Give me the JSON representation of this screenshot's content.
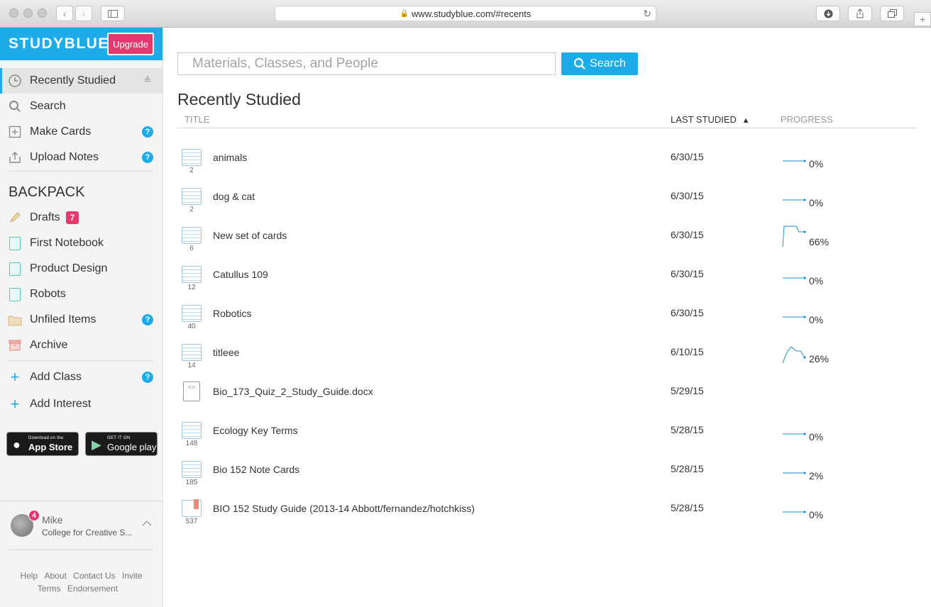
{
  "browser": {
    "url": "www.studyblue.com/#recents"
  },
  "sidebar": {
    "logo": "STUDYBLUE",
    "upgrade_label": "Upgrade",
    "nav": [
      {
        "label": "Recently Studied",
        "icon": "clock-icon",
        "active": true
      },
      {
        "label": "Search",
        "icon": "search-icon"
      },
      {
        "label": "Make Cards",
        "icon": "plus-square-icon",
        "help": "?"
      },
      {
        "label": "Upload Notes",
        "icon": "upload-icon",
        "help": "?"
      }
    ],
    "backpack_title": "BACKPACK",
    "backpack": [
      {
        "label": "Drafts",
        "icon": "pencil-icon",
        "badge": "7"
      },
      {
        "label": "First Notebook",
        "icon": "notebook-icon"
      },
      {
        "label": "Product Design",
        "icon": "notebook-icon"
      },
      {
        "label": "Robots",
        "icon": "notebook-icon"
      },
      {
        "label": "Unfiled Items",
        "icon": "folder-icon",
        "help": "?"
      },
      {
        "label": "Archive",
        "icon": "archive-icon"
      }
    ],
    "add": [
      {
        "label": "Add Class",
        "help": "?"
      },
      {
        "label": "Add Interest"
      }
    ],
    "stores": {
      "apple_small": "Download on the",
      "apple_big": "App Store",
      "google_small": "GET IT ON",
      "google_big": "Google play"
    },
    "profile": {
      "name": "Mike",
      "school": "College for Creative S...",
      "notifications": "4"
    },
    "footer_row1": [
      "Help",
      "About",
      "Contact Us",
      "Invite"
    ],
    "footer_row2": [
      "Terms",
      "Endorsement"
    ]
  },
  "main": {
    "search_placeholder": "Materials, Classes, and People",
    "search_button": "Search",
    "title": "Recently Studied",
    "columns": {
      "title": "TITLE",
      "last_studied": "LAST STUDIED",
      "sort_indicator": "▲",
      "progress": "PROGRESS"
    },
    "rows": [
      {
        "title": "animals",
        "count": "2",
        "date": "6/30/15",
        "progress": "0%",
        "progress_value": 0,
        "kind": "cards"
      },
      {
        "title": "dog & cat",
        "count": "2",
        "date": "6/30/15",
        "progress": "0%",
        "progress_value": 0,
        "kind": "cards"
      },
      {
        "title": "New set of cards",
        "count": "6",
        "date": "6/30/15",
        "progress": "66%",
        "progress_value": 66,
        "kind": "cards"
      },
      {
        "title": "Catullus 109",
        "count": "12",
        "date": "6/30/15",
        "progress": "0%",
        "progress_value": 0,
        "kind": "cards"
      },
      {
        "title": "Robotics",
        "count": "40",
        "date": "6/30/15",
        "progress": "0%",
        "progress_value": 0,
        "kind": "cards"
      },
      {
        "title": "titleee",
        "count": "14",
        "date": "6/10/15",
        "progress": "26%",
        "progress_value": 26,
        "kind": "cards"
      },
      {
        "title": "Bio_173_Quiz_2_Study_Guide.docx",
        "count": "",
        "date": "5/29/15",
        "progress": "",
        "kind": "doc"
      },
      {
        "title": "Ecology Key Terms",
        "count": "148",
        "date": "5/28/15",
        "progress": "0%",
        "progress_value": 0,
        "kind": "cards"
      },
      {
        "title": "Bio 152 Note Cards",
        "count": "185",
        "date": "5/28/15",
        "progress": "2%",
        "progress_value": 2,
        "kind": "cards"
      },
      {
        "title": "BIO 152 Study Guide (2013-14 Abbott/fernandez/hotchkiss)",
        "count": "537",
        "date": "5/28/15",
        "progress": "0%",
        "progress_value": 0,
        "kind": "guide"
      }
    ]
  }
}
